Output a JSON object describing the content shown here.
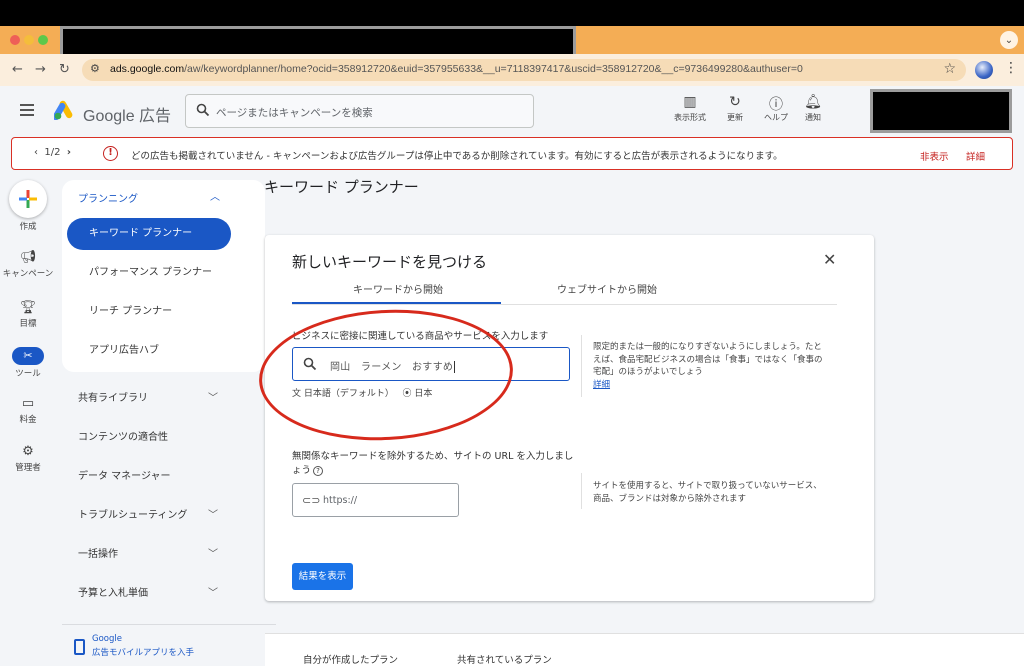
{
  "browser": {
    "url_host": "ads.google.com",
    "url_path": "/aw/keywordplanner/home?ocid=358912720&euid=357955633&__u=7118397417&uscid=358912720&__c=9736499280&authuser=0",
    "icons": [
      "back-icon",
      "forward-icon",
      "reload-icon",
      "site-info-icon",
      "bookmark-star-icon",
      "profile-avatar",
      "menu-kebab-icon"
    ]
  },
  "header": {
    "logo_text": "Google 広告",
    "search_placeholder": "ページまたはキャンペーンを検索",
    "tools": [
      {
        "label": "表示形式",
        "icon": "appearance-icon"
      },
      {
        "label": "更新",
        "icon": "refresh-icon"
      },
      {
        "label": "ヘルプ",
        "icon": "help-icon"
      },
      {
        "label": "通知",
        "icon": "bell-icon"
      }
    ]
  },
  "alert": {
    "pager": "1/2",
    "message": "どの広告も掲載されていません - キャンペーンおよび広告グループは停止中であるか削除されています。有効にすると広告が表示されるようになります。",
    "dismiss": "非表示",
    "details": "詳細"
  },
  "rail": {
    "create": "作成",
    "campaigns": "キャンペーン",
    "goals": "目標",
    "tools": "ツール",
    "billing": "料金",
    "admin": "管理者"
  },
  "nav": {
    "planning_header": "プランニング",
    "planning_items": [
      "キーワード プランナー",
      "パフォーマンス プランナー",
      "リーチ プランナー",
      "アプリ広告ハブ"
    ],
    "sections": [
      {
        "label": "共有ライブラリ",
        "expandable": true
      },
      {
        "label": "コンテンツの適合性",
        "expandable": false
      },
      {
        "label": "データ マネージャー",
        "expandable": false
      },
      {
        "label": "トラブルシューティング",
        "expandable": true
      },
      {
        "label": "一括操作",
        "expandable": true
      },
      {
        "label": "予算と入札単価",
        "expandable": true
      }
    ],
    "mobile_promo_line1": "Google",
    "mobile_promo_line2": "広告モバイルアプリを入手"
  },
  "main": {
    "page_title": "キーワード プランナー",
    "card_title": "新しいキーワードを見つける",
    "tab_keywords": "キーワードから開始",
    "tab_website": "ウェブサイトから開始",
    "keyword_label": "ビジネスに密接に関連している商品やサービスを入力します",
    "keyword_value": "岡山　ラーメン　おすすめ",
    "language": "日本語（デフォルト）",
    "location": "日本",
    "keyword_hint": "限定的または一般的になりすぎないようにしましょう。たとえば、食品宅配ビジネスの場合は「食事」ではなく「食事の宅配」のほうがよいでしょう",
    "keyword_hint_link": "詳細",
    "url_label": "無関係なキーワードを除外するため、サイトの URL を入力しましょう",
    "url_placeholder": "https://",
    "url_hint": "サイトを使用すると、サイトで取り扱っていないサービス、商品、ブランドは対象から除外されます",
    "submit": "結果を表示"
  },
  "plans": {
    "mine": "自分が作成したプラン",
    "shared": "共有されているプラン"
  },
  "colors": {
    "accent": "#1a57c5",
    "primary_button": "#1a73e8",
    "alert_red": "#d93025",
    "annotation_red": "#d72a1c",
    "tab_strip": "#f4ad55"
  }
}
